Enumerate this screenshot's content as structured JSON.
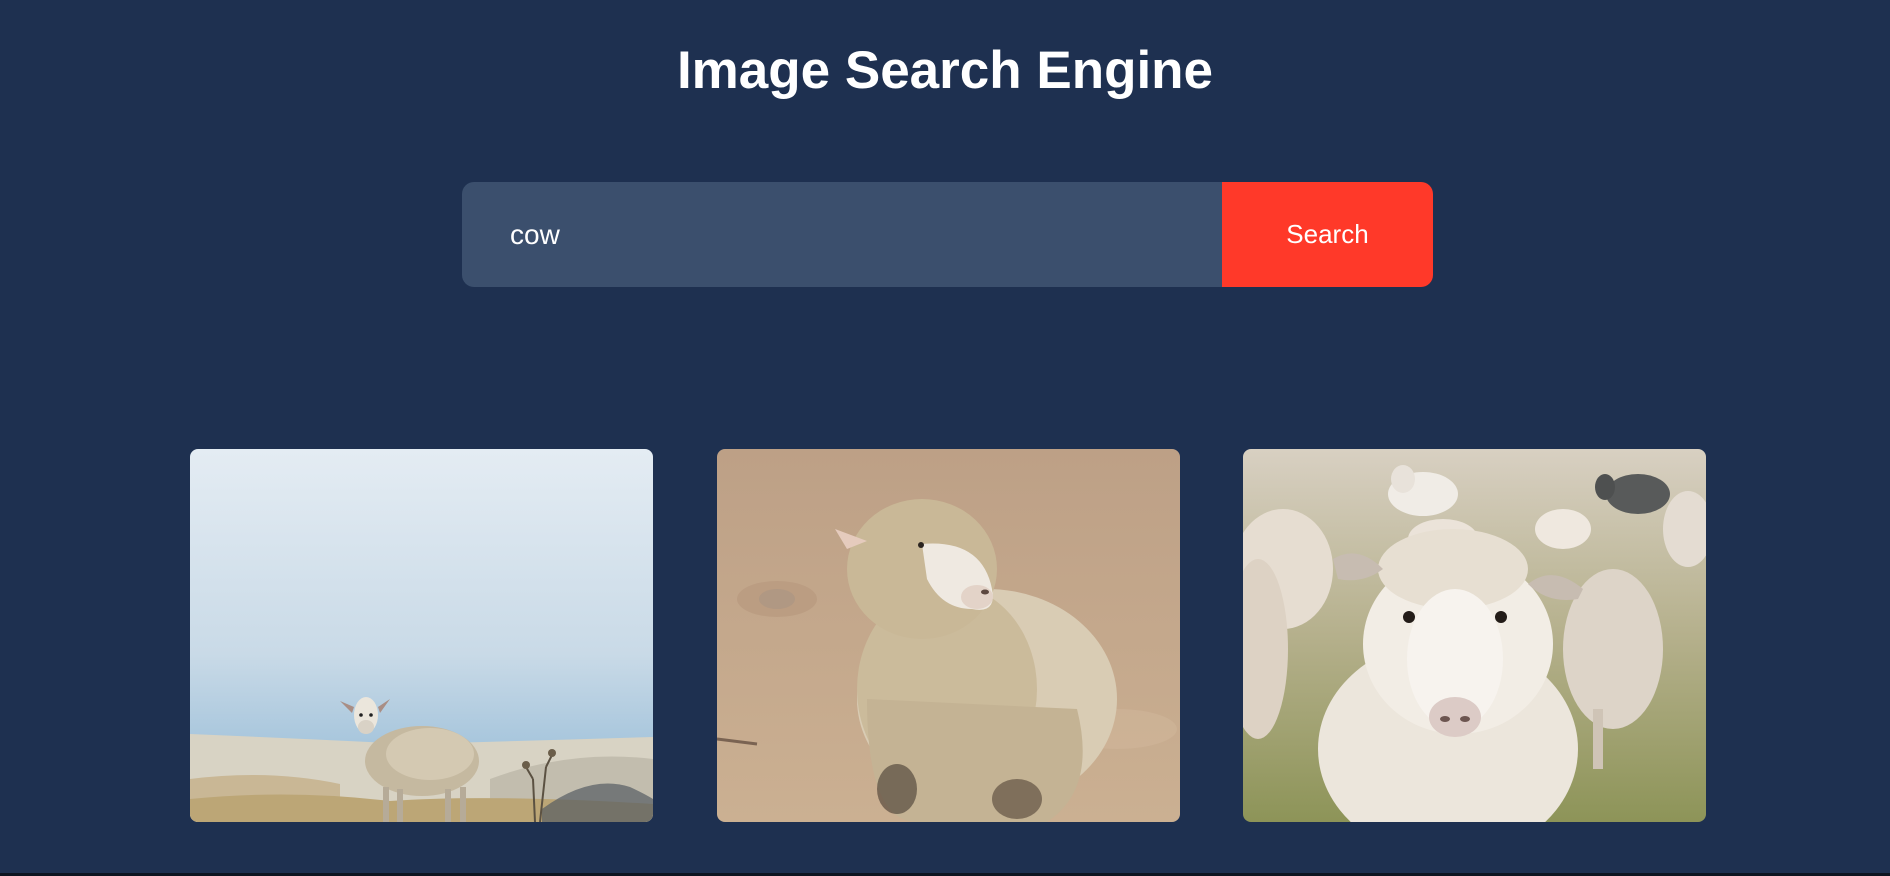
{
  "header": {
    "title": "Image Search Engine"
  },
  "search": {
    "value": "cow",
    "button_label": "Search"
  },
  "results": [
    {
      "icon": "sheep-photo"
    },
    {
      "icon": "sheep-photo"
    },
    {
      "icon": "sheep-photo"
    }
  ],
  "colors": {
    "background": "#1e3050",
    "input": "#3b4f6d",
    "accent": "#ff3929"
  }
}
